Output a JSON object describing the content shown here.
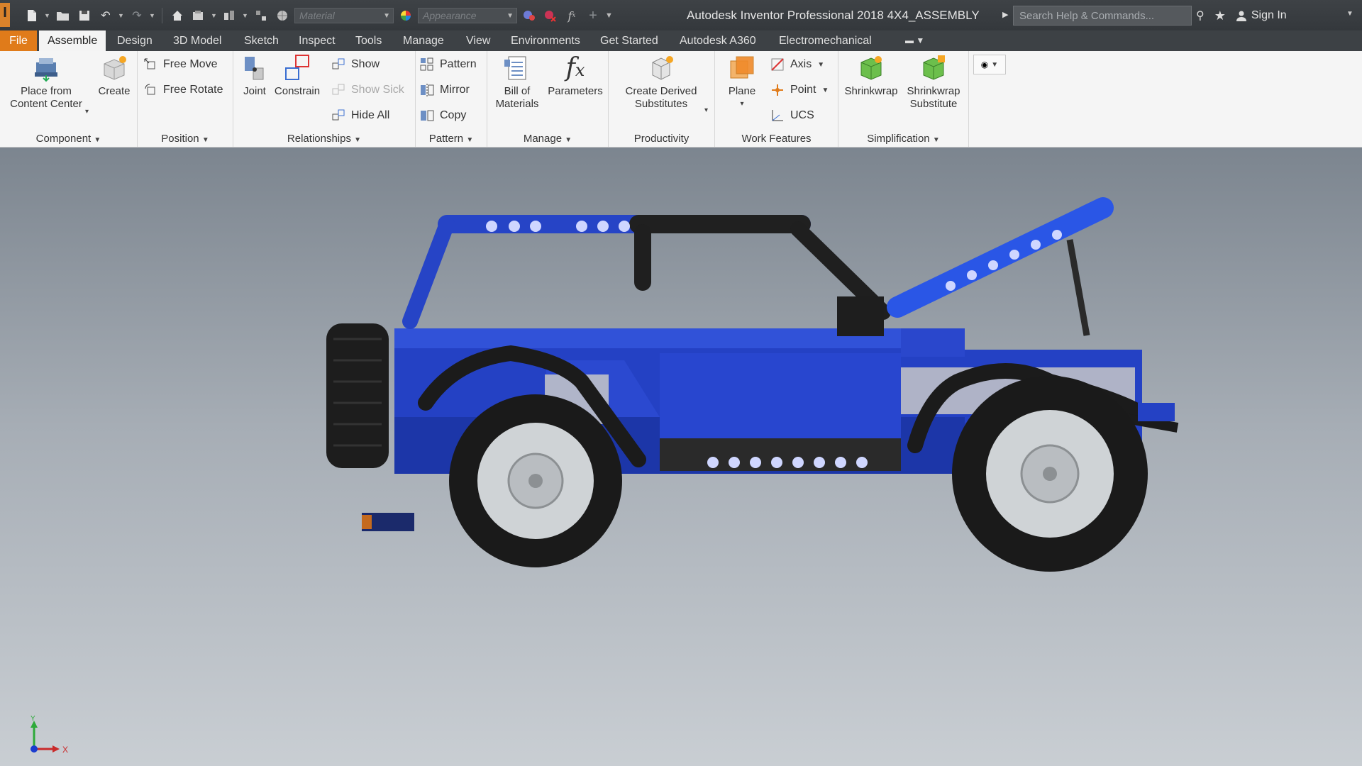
{
  "titlebar": {
    "app_logo": "I",
    "material_placeholder": "Material",
    "appearance_placeholder": "Appearance",
    "app_title": "Autodesk Inventor Professional 2018   4X4_ASSEMBLY",
    "search_placeholder": "Search Help & Commands...",
    "sign_in": "Sign In"
  },
  "tabs": [
    {
      "label": "File"
    },
    {
      "label": "Assemble"
    },
    {
      "label": "Design"
    },
    {
      "label": "3D Model"
    },
    {
      "label": "Sketch"
    },
    {
      "label": "Inspect"
    },
    {
      "label": "Tools"
    },
    {
      "label": "Manage"
    },
    {
      "label": "View"
    },
    {
      "label": "Environments"
    },
    {
      "label": "Get Started"
    },
    {
      "label": "Autodesk A360"
    },
    {
      "label": "Electromechanical"
    }
  ],
  "ribbon": {
    "component": {
      "title": "Component",
      "place_line1": "Place from",
      "place_line2": "Content Center",
      "create": "Create"
    },
    "position": {
      "title": "Position",
      "free_move": "Free Move",
      "free_rotate": "Free Rotate"
    },
    "relationships": {
      "title": "Relationships",
      "joint": "Joint",
      "constrain": "Constrain",
      "show": "Show",
      "show_sick": "Show Sick",
      "hide_all": "Hide All"
    },
    "pattern": {
      "title": "Pattern",
      "pattern": "Pattern",
      "mirror": "Mirror",
      "copy": "Copy"
    },
    "manage": {
      "title": "Manage",
      "bom_line1": "Bill of",
      "bom_line2": "Materials",
      "parameters": "Parameters"
    },
    "productivity": {
      "title": "Productivity",
      "derived_line1": "Create Derived",
      "derived_line2": "Substitutes"
    },
    "work_features": {
      "title": "Work Features",
      "plane": "Plane",
      "axis": "Axis",
      "point": "Point",
      "ucs": "UCS"
    },
    "simplification": {
      "title": "Simplification",
      "shrinkwrap": "Shrinkwrap",
      "sw_sub_line1": "Shrinkwrap",
      "sw_sub_line2": "Substitute"
    }
  },
  "viewport": {
    "triad_x": "X",
    "triad_y": "Y",
    "background_top": "#7c858f",
    "background_bottom": "#c9ced3",
    "model_color": "#1f3fbf"
  },
  "colors": {
    "file_tab": "#e07b1a",
    "titlebar": "#3e4246",
    "ribbon": "#f5f5f5"
  }
}
